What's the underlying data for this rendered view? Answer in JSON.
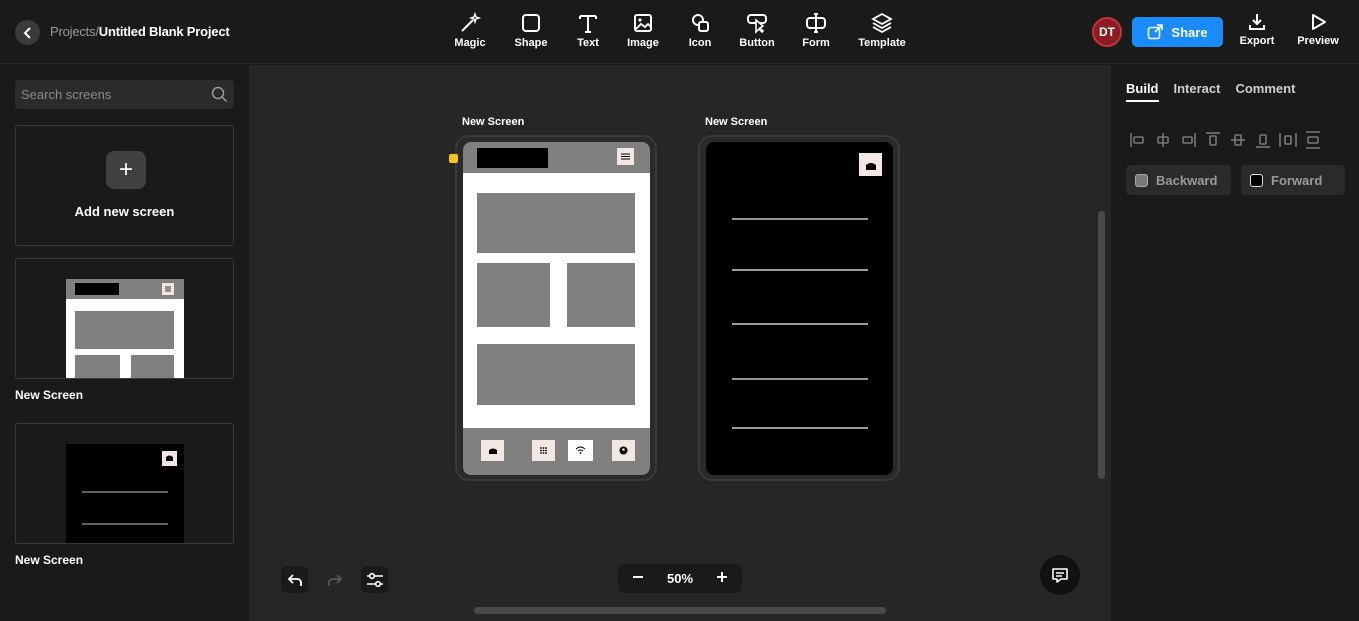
{
  "header": {
    "breadcrumb_parent": "Projects",
    "breadcrumb_sep": "/",
    "project_name": "Untitled Blank Project",
    "tools": [
      {
        "label": "Magic",
        "icon": "magic-wand-icon"
      },
      {
        "label": "Shape",
        "icon": "square-icon"
      },
      {
        "label": "Text",
        "icon": "text-icon"
      },
      {
        "label": "Image",
        "icon": "image-icon"
      },
      {
        "label": "Icon",
        "icon": "shapes-icon"
      },
      {
        "label": "Button",
        "icon": "pointer-icon"
      },
      {
        "label": "Form",
        "icon": "text-cursor-icon"
      },
      {
        "label": "Template",
        "icon": "layers-icon"
      }
    ],
    "avatar_initials": "DT",
    "share_label": "Share",
    "export_label": "Export",
    "preview_label": "Preview"
  },
  "left_panel": {
    "search_placeholder": "Search screens",
    "add_screen_label": "Add new screen",
    "screens": [
      {
        "label": "New Screen"
      },
      {
        "label": "New Screen"
      }
    ]
  },
  "canvas": {
    "screen1_label": "New Screen",
    "screen2_label": "New Screen",
    "zoom_level": "50%"
  },
  "right_panel": {
    "tabs": [
      "Build",
      "Interact",
      "Comment"
    ],
    "active_tab": "Build",
    "backward_label": "Backward",
    "forward_label": "Forward"
  },
  "colors": {
    "accent": "#1a8cff",
    "avatar_bg": "#8a1c22",
    "wire_gray": "#808080",
    "highlight_yellow": "#f5c518"
  }
}
